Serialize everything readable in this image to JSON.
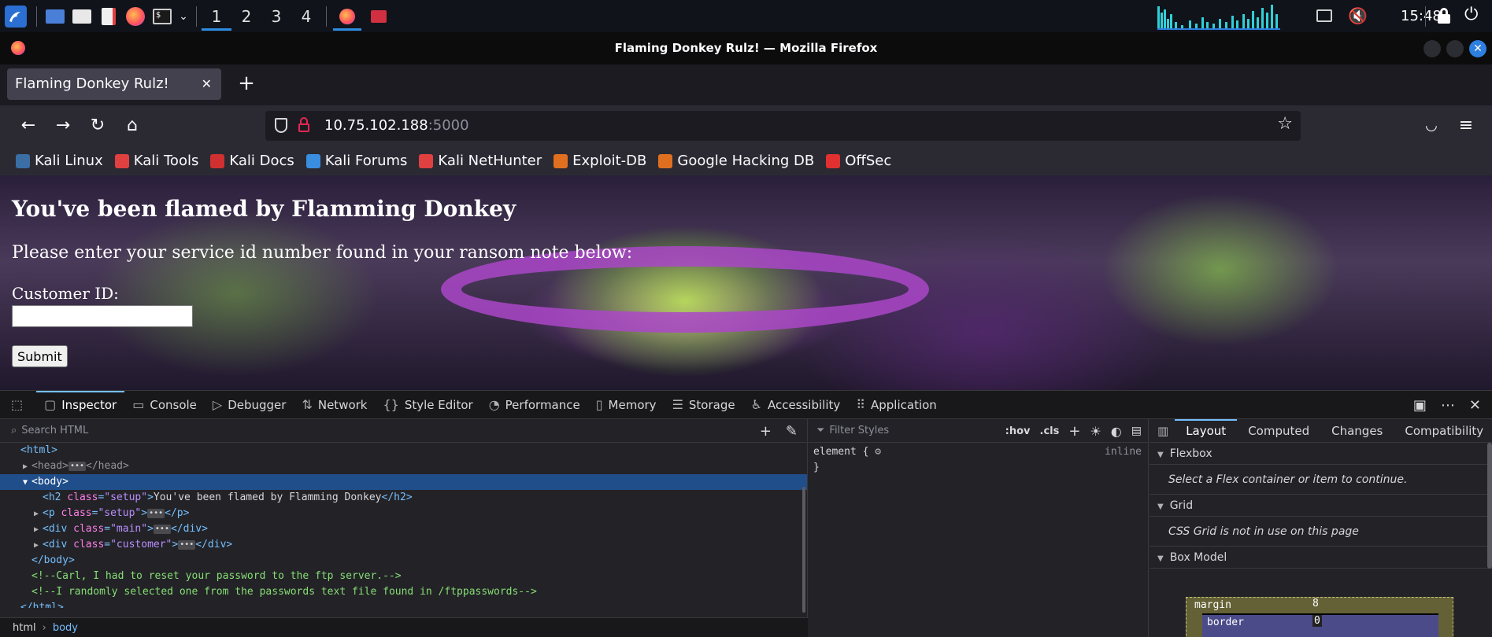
{
  "panel": {
    "workspaces": [
      "1",
      "2",
      "3",
      "4"
    ],
    "clock": "15:48"
  },
  "window": {
    "title": "Flaming Donkey Rulz! — Mozilla Firefox"
  },
  "tab": {
    "label": "Flaming Donkey Rulz!"
  },
  "url": {
    "host": "10.75.102.188",
    "port": ":5000"
  },
  "bookmarks": [
    {
      "label": "Kali Linux",
      "color": "#3a6ea5"
    },
    {
      "label": "Kali Tools",
      "color": "#e04040"
    },
    {
      "label": "Kali Docs",
      "color": "#d03030"
    },
    {
      "label": "Kali Forums",
      "color": "#3a8ee0"
    },
    {
      "label": "Kali NetHunter",
      "color": "#e04040"
    },
    {
      "label": "Exploit-DB",
      "color": "#e07020"
    },
    {
      "label": "Google Hacking DB",
      "color": "#e07020"
    },
    {
      "label": "OffSec",
      "color": "#e03030"
    }
  ],
  "page": {
    "heading": "You've been flamed by Flamming Donkey",
    "prompt": "Please enter your service id number found in your ransom note below:",
    "customer_label": "Customer ID:",
    "submit_label": "Submit"
  },
  "devtools": {
    "tabs": [
      "Inspector",
      "Console",
      "Debugger",
      "Network",
      "Style Editor",
      "Performance",
      "Memory",
      "Storage",
      "Accessibility",
      "Application"
    ],
    "search_placeholder": "Search HTML",
    "filter_placeholder": "Filter Styles",
    "hov": ":hov",
    "cls": ".cls",
    "element_rule_open": "element {",
    "element_rule_close": "}",
    "inline": "inline",
    "tree": {
      "html_open": "<html>",
      "head": "<head>",
      "head_close": "</head>",
      "body_open": "<body>",
      "h2_tag": "h2",
      "h2_class_attr": "class",
      "h2_class_val": "\"setup\"",
      "h2_text": "You've been flamed by Flamming Donkey",
      "p_tag": "p",
      "p_class_val": "\"setup\"",
      "div_main_val": "\"main\"",
      "div_customer_val": "\"customer\"",
      "body_close": "</body>",
      "comment1": "<!--Carl, I had to reset your password to the ftp server.-->",
      "comment2": "<!--I randomly selected one from the passwords text file found in /ftppasswords-->",
      "html_close": "</html>"
    },
    "breadcrumbs": [
      "html",
      "body"
    ],
    "layout_tabs": [
      "Layout",
      "Computed",
      "Changes",
      "Compatibility"
    ],
    "flexbox": "Flexbox",
    "flexbox_hint": "Select a Flex container or item to continue.",
    "grid": "Grid",
    "grid_hint": "CSS Grid is not in use on this page",
    "box_model": "Box Model",
    "margin_label": "margin",
    "margin_value": "8",
    "border_label": "border",
    "border_value": "0"
  }
}
